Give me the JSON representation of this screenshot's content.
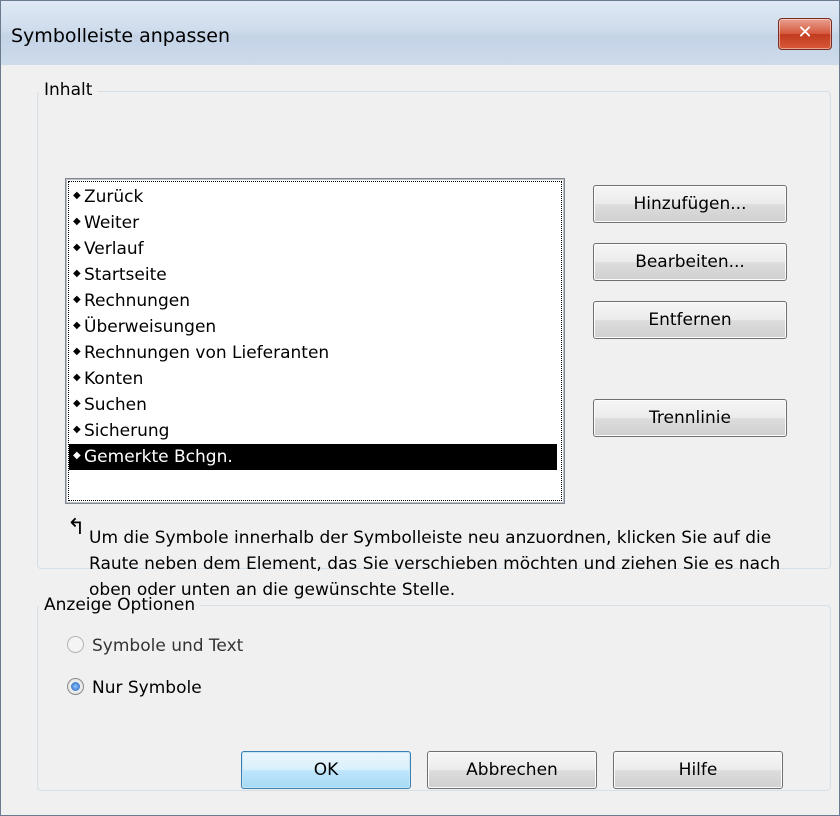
{
  "window": {
    "title": "Symbolleiste anpassen",
    "close_glyph": "✕"
  },
  "content_group": {
    "legend": "Inhalt",
    "items": [
      {
        "label": "Zurück",
        "selected": false
      },
      {
        "label": "Weiter",
        "selected": false
      },
      {
        "label": "Verlauf",
        "selected": false
      },
      {
        "label": "Startseite",
        "selected": false
      },
      {
        "label": "Rechnungen",
        "selected": false
      },
      {
        "label": "Überweisungen",
        "selected": false
      },
      {
        "label": "Rechnungen von Lieferanten",
        "selected": false
      },
      {
        "label": "Konten",
        "selected": false
      },
      {
        "label": "Suchen",
        "selected": false
      },
      {
        "label": "Sicherung",
        "selected": false
      },
      {
        "label": "Gemerkte Bchgn.",
        "selected": true
      }
    ],
    "item_marker": "◆",
    "buttons": {
      "add_label": "Hinzufügen...",
      "edit_label": "Bearbeiten...",
      "remove_label": "Entfernen",
      "separator_label": "Trennlinie"
    },
    "note_arrow": "↰",
    "note": "Um die Symbole innerhalb der Symbolleiste neu anzuordnen, klicken Sie auf die Raute neben dem Element, das Sie verschieben möchten und ziehen Sie es nach oben oder unten an die gewünschte Stelle."
  },
  "display_group": {
    "legend": "Anzeige Optionen",
    "options": [
      {
        "label": "Symbole und Text",
        "checked": false
      },
      {
        "label": "Nur Symbole",
        "checked": true
      }
    ]
  },
  "footer": {
    "ok_label": "OK",
    "cancel_label": "Abbrechen",
    "help_label": "Hilfe"
  },
  "colors": {
    "selection_bg": "#000000",
    "close_button": "#c9452a"
  }
}
